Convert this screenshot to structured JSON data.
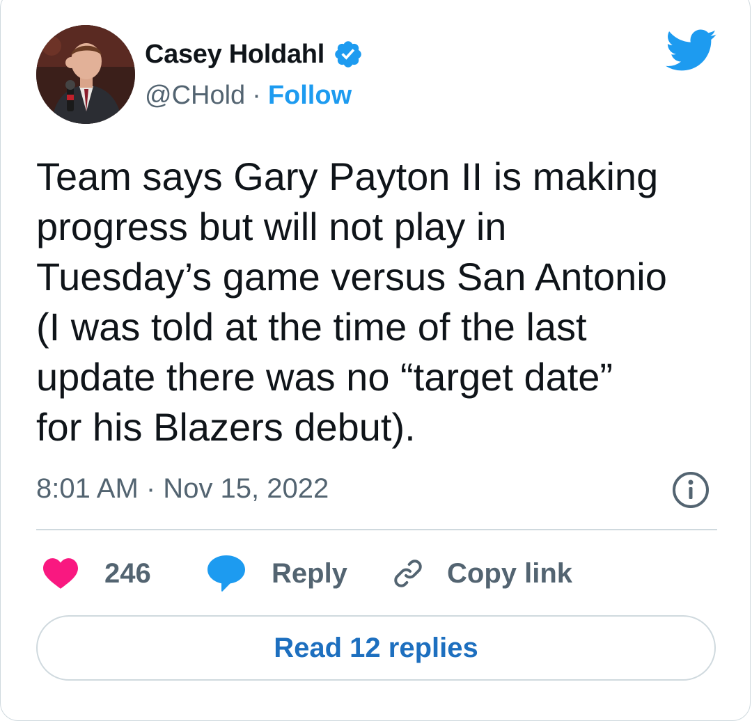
{
  "author": {
    "name": "Casey Holdahl",
    "handle": "@CHold",
    "separator": "·",
    "follow_label": "Follow",
    "verified": true
  },
  "tweet": {
    "text": "Team says Gary Payton II is making\nprogress but will not play in\nTuesday’s game versus San Antonio\n(I was told at the time of the last\nupdate there was no “target date”\nfor his Blazers debut).",
    "timestamp": "8:01 AM · Nov 15, 2022"
  },
  "actions": {
    "like_count": "246",
    "reply_label": "Reply",
    "copy_link_label": "Copy link"
  },
  "read_replies_label": "Read 12 replies",
  "icons": {
    "brand": "twitter-bird-icon",
    "verified": "verified-badge-icon",
    "info": "info-icon",
    "like": "heart-icon",
    "reply": "speech-bubble-icon",
    "copy": "link-icon"
  },
  "colors": {
    "brand_blue": "#1d9bf0",
    "heart": "#f91880",
    "text_primary": "#0f1419",
    "text_secondary": "#536471",
    "border": "#cfd9de"
  }
}
